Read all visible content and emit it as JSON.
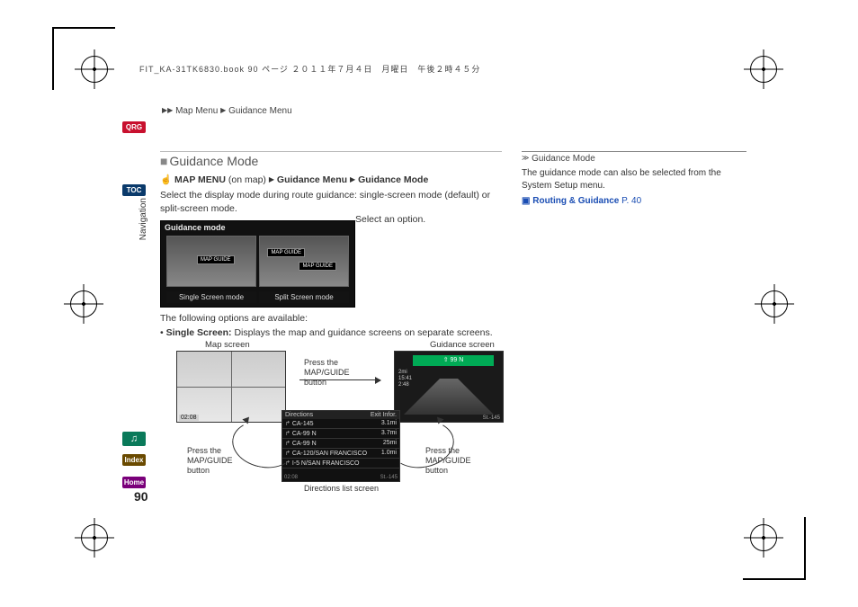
{
  "meta": {
    "header": "FIT_KA-31TK6830.book  90 ページ  ２０１１年７月４日　月曜日　午後２時４５分"
  },
  "breadcrumb": {
    "arrows": "▶▶",
    "a": "Map Menu",
    "sep": "▶",
    "b": "Guidance Menu"
  },
  "tabs": {
    "qrg": "QRG",
    "toc": "TOC",
    "voice": "♫",
    "index": "Index",
    "home": "Home"
  },
  "vnav": "Navigation",
  "pagenum": "90",
  "section": {
    "square": "■",
    "title": "Guidance Mode",
    "path_icon": "☝",
    "path_a": "MAP MENU",
    "path_note": " (on map) ",
    "path_b": "Guidance Menu",
    "path_c": "Guidance Mode",
    "body": "Select the display mode during route guidance: single-screen mode (default) or split-screen mode.",
    "select": "Select an option.",
    "following": "The following options are available:",
    "bullet_b": "Single Screen:",
    "bullet_rest": " Displays the map and guidance screens on separate screens."
  },
  "shot1": {
    "title": "Guidance mode",
    "left": "Single Screen mode",
    "right": "Split Screen mode",
    "tag": "MAP GUIDE"
  },
  "diagram": {
    "map_label": "Map screen",
    "guide_label": "Guidance screen",
    "dir_label": "Directions list screen",
    "press": "Press the MAP/GUIDE button",
    "clock": "02:08",
    "sign": "⇧  99 N",
    "info1": "2mi",
    "info2": "15:41",
    "info3": "2:48",
    "srt": "St.-145"
  },
  "dirlist": {
    "hdr_l": "Directions",
    "hdr_r": "Exit Infor.",
    "rows": [
      {
        "l": "CA-145",
        "r": "3.1mi"
      },
      {
        "l": "CA-99 N",
        "r": "3.7mi"
      },
      {
        "l": "CA-99 N",
        "r": "25mi"
      },
      {
        "l": "CA-120/SAN FRANCISCO",
        "r": "1.0mi"
      },
      {
        "l": "I-5 N/SAN FRANCISCO",
        "r": ""
      }
    ],
    "clock": "02:08",
    "srt": "St.-145"
  },
  "side": {
    "box": "≫",
    "title": "Guidance Mode",
    "body": "The guidance mode can also be selected from the System Setup menu.",
    "xref_icon": "▣",
    "xref_label": "Routing & Guidance",
    "xref_page": " P. 40"
  }
}
